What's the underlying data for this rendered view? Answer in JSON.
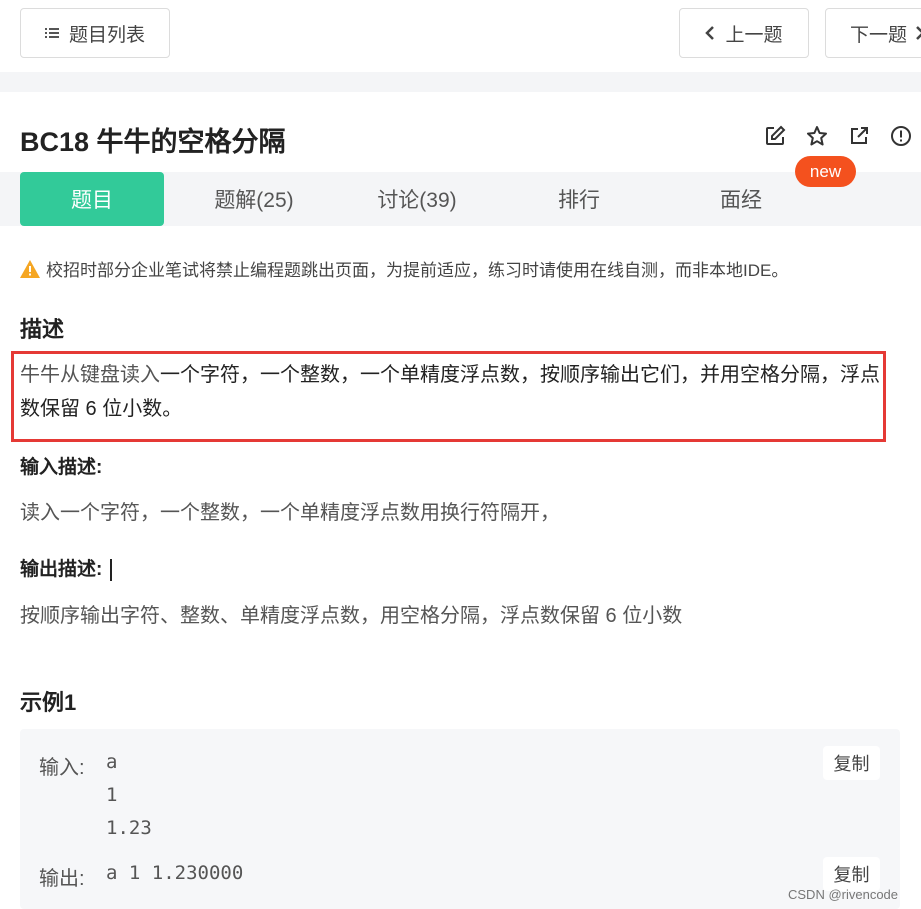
{
  "header": {
    "problem_list": "题目列表",
    "prev": "上一题",
    "next": "下一题"
  },
  "problem": {
    "title": "BC18  牛牛的空格分隔",
    "new_badge": "new"
  },
  "tabs": [
    {
      "label": "题目",
      "active": true
    },
    {
      "label": "题解(25)"
    },
    {
      "label": "讨论(39)"
    },
    {
      "label": "排行"
    },
    {
      "label": "面经"
    }
  ],
  "notice": "校招时部分企业笔试将禁止编程题跳出页面，为提前适应，练习时请使用在线自测，而非本地IDE。",
  "description": {
    "heading": "描述",
    "lead": "牛牛从键盘读入",
    "rest": "一个字符，一个整数，一个单精度浮点数，按顺序输出它们，并用空格分隔，浮点数保留 6 位小数。"
  },
  "input_desc": {
    "heading": "输入描述:",
    "text": "读入一个字符，一个整数，一个单精度浮点数用换行符隔开，"
  },
  "output_desc": {
    "heading": "输出描述:",
    "text": "按顺序输出字符、整数、单精度浮点数，用空格分隔，浮点数保留 6 位小数"
  },
  "example": {
    "heading": "示例1",
    "input_label": "输入:",
    "input_lines": [
      "a",
      "1",
      "1.23"
    ],
    "output_label": "输出:",
    "output": "a 1 1.230000",
    "copy": "复制"
  },
  "watermark": "CSDN @rivencode",
  "colors": {
    "accent": "#32ca99",
    "badge": "#f4511e",
    "highlight_border": "#e53935"
  }
}
